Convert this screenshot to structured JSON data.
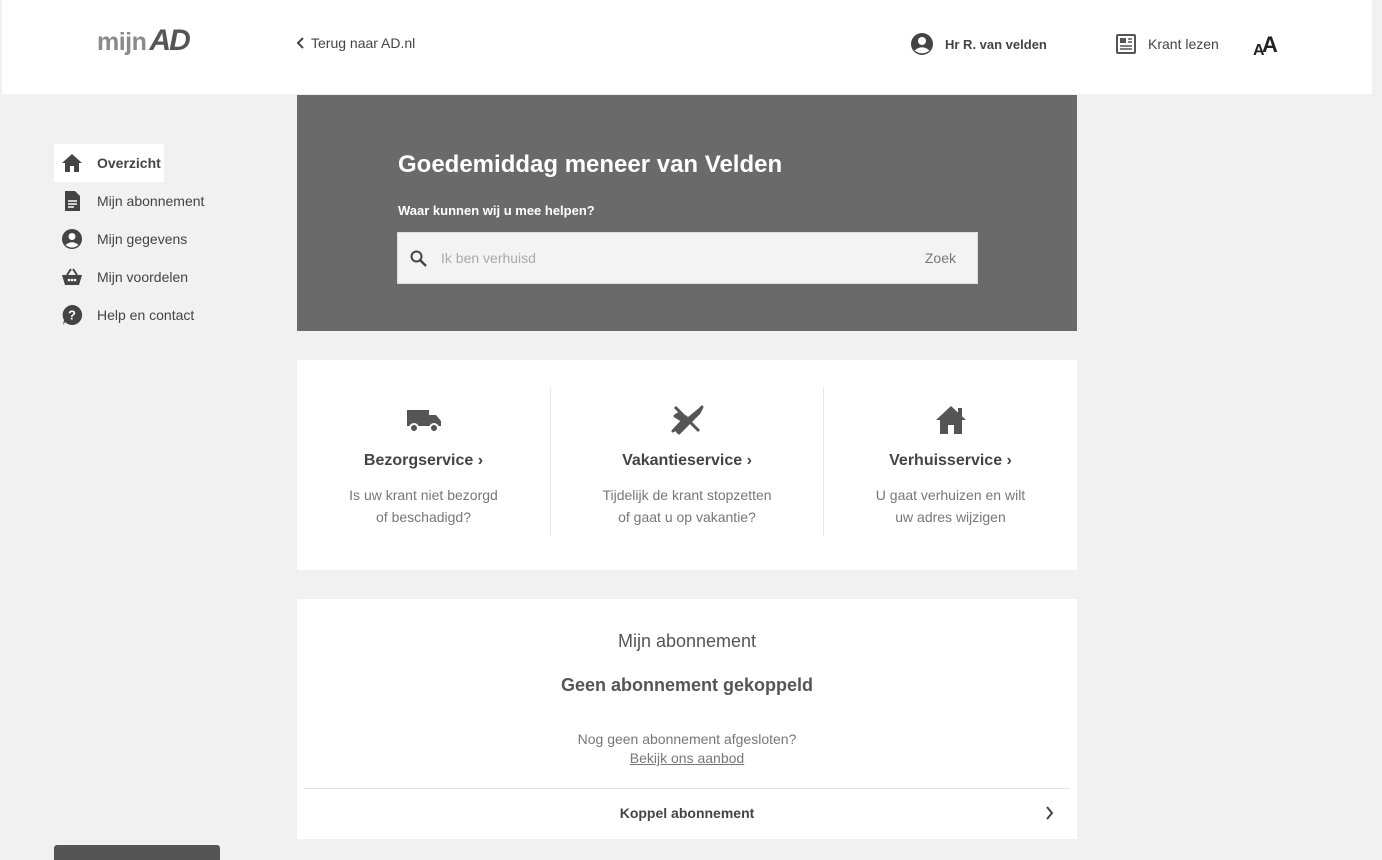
{
  "header": {
    "logo_mijn": "mijn",
    "logo_ad": "AD",
    "back_link": "Terug naar AD.nl",
    "user_name": "Hr R. van velden",
    "read_paper": "Krant lezen"
  },
  "sidebar": {
    "items": [
      {
        "label": "Overzicht",
        "icon": "home-icon",
        "active": true
      },
      {
        "label": "Mijn abonnement",
        "icon": "document-icon"
      },
      {
        "label": "Mijn gegevens",
        "icon": "account-icon"
      },
      {
        "label": "Mijn voordelen",
        "icon": "basket-icon"
      },
      {
        "label": "Help en contact",
        "icon": "help-icon"
      }
    ]
  },
  "hero": {
    "greeting": "Goedemiddag meneer van Velden",
    "subtitle": "Waar kunnen wij u mee helpen?",
    "search_placeholder": "Ik ben verhuisd",
    "search_button": "Zoek"
  },
  "services": [
    {
      "title": "Bezorgservice",
      "line1": "Is uw krant niet bezorgd",
      "line2": "of beschadigd?",
      "icon": "truck-icon"
    },
    {
      "title": "Vakantieservice",
      "line1": "Tijdelijk de krant stopzetten",
      "line2": "of gaat u op vakantie?",
      "icon": "plane-icon"
    },
    {
      "title": "Verhuisservice",
      "line1": "U gaat verhuizen en wilt",
      "line2": "uw adres wijzigen",
      "icon": "house-icon"
    }
  ],
  "subscription": {
    "heading": "Mijn abonnement",
    "status": "Geen abonnement gekoppeld",
    "question": "Nog geen abonnement afgesloten?",
    "offer_link": "Bekijk ons aanbod",
    "connect": "Koppel abonnement"
  },
  "colors": {
    "hero_bg": "#6a6a6a",
    "page_bg": "#f1f1f1",
    "text": "#444444"
  }
}
